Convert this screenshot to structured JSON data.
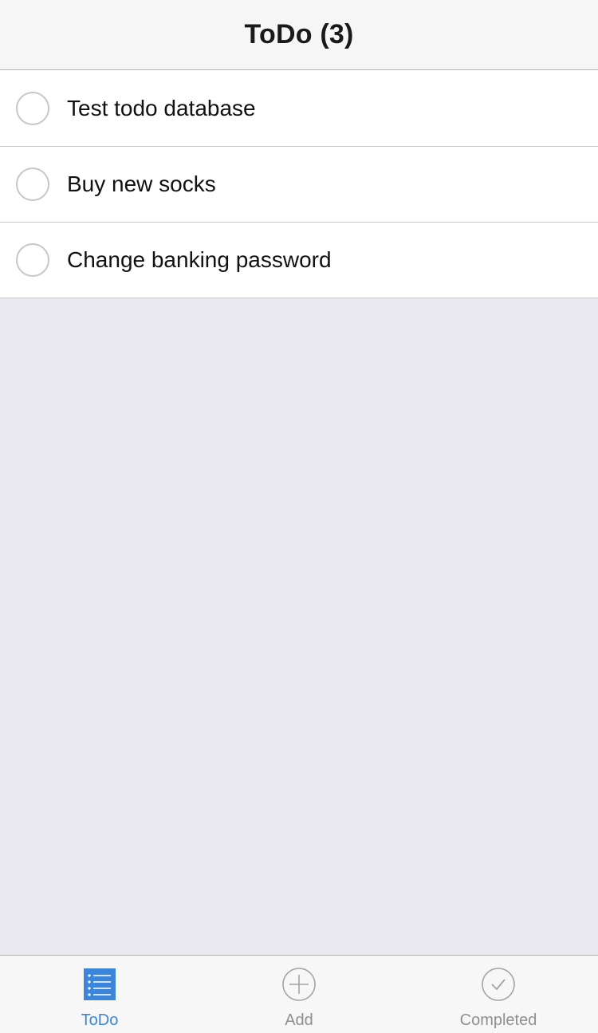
{
  "header": {
    "title": "ToDo (3)"
  },
  "todos": [
    {
      "label": "Test todo database",
      "done": false
    },
    {
      "label": "Buy new socks",
      "done": false
    },
    {
      "label": "Change banking password",
      "done": false
    }
  ],
  "tabbar": {
    "tabs": [
      {
        "label": "ToDo",
        "icon": "list-icon",
        "active": true
      },
      {
        "label": "Add",
        "icon": "plus-circle-icon",
        "active": false
      },
      {
        "label": "Completed",
        "icon": "checkmark-circle-icon",
        "active": false
      }
    ]
  },
  "colors": {
    "accent": "#3b86db",
    "inactive": "#8e8e93",
    "background": "#e9e8ee"
  }
}
